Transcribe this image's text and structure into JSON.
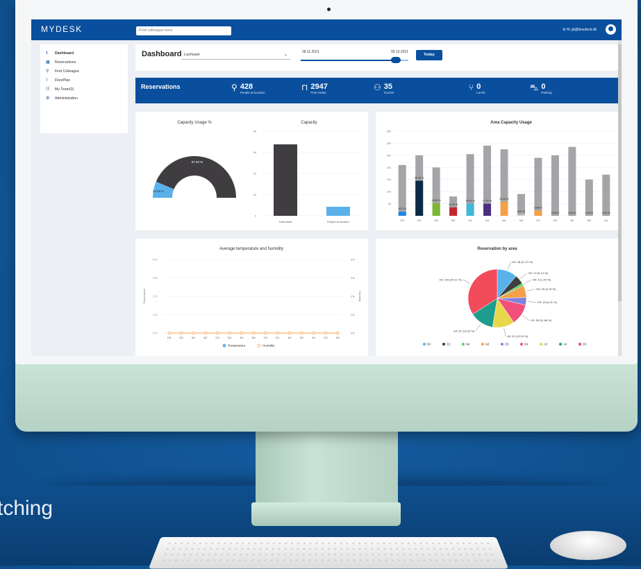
{
  "caption": "tching",
  "app": {
    "logo": "MYDESK",
    "search_placeholder": "Find colleague here",
    "user_greeting": "Hi, jb@bluedock.dk"
  },
  "sidebar": {
    "items": [
      {
        "label": "Dashboard",
        "icon": "chart-line-icon",
        "active": true
      },
      {
        "label": "Reservations",
        "icon": "calendar-icon",
        "active": false
      },
      {
        "label": "Find Colleague",
        "icon": "search-icon",
        "active": false
      },
      {
        "label": "FloorPlan",
        "icon": "chart-line-icon",
        "active": false
      },
      {
        "label": "My Team(3)",
        "icon": "team-icon",
        "active": false
      },
      {
        "label": "Administration",
        "icon": "gear-icon",
        "active": false
      }
    ]
  },
  "filter": {
    "title": "Dashboard",
    "location": "Lavhuset",
    "date_from": "28.11.2021",
    "date_to": "05.12.2021",
    "range_fraction": 0.93,
    "today_label": "Today"
  },
  "reservations": {
    "title": "Reservations",
    "stats": [
      {
        "value": "428",
        "label": "People at location",
        "icon": "map-pin-icon"
      },
      {
        "value": "2947",
        "label": "Free Seats",
        "icon": "seat-icon"
      },
      {
        "value": "35",
        "label": "Guests",
        "icon": "users-icon"
      },
      {
        "value": "0",
        "label": "Lunch",
        "icon": "cutlery-icon"
      },
      {
        "value": "0",
        "label": "Parking",
        "icon": "car-icon"
      }
    ]
  },
  "colors": {
    "primary": "#0a4f9e",
    "dark_bar": "#3f3d40",
    "light_blue": "#5ab1ea",
    "grey_bar": "#a4a5a8",
    "orange_line": "#f4a04a"
  },
  "chart_data": [
    {
      "type": "pie",
      "title": "Capacity Usage %",
      "values": [
        87.32,
        12.68
      ],
      "labels": [
        "87.32 %",
        "12.68 %"
      ],
      "colors": [
        "#3f3d40",
        "#5ab1ea"
      ]
    },
    {
      "type": "bar",
      "title": "Capacity",
      "categories": [
        "Total seats",
        "People at location"
      ],
      "values": [
        3375,
        428
      ],
      "colors": [
        "#3f3d40",
        "#5ab1ea"
      ],
      "ylim": [
        0,
        4000
      ],
      "yticks": [
        "0",
        "1k",
        "2k",
        "3k",
        "4k"
      ]
    },
    {
      "type": "bar",
      "title": "Area Capacity Usage",
      "categories": [
        "D2",
        "D3",
        "A3",
        "N3",
        "O4",
        "D4",
        "A4",
        "N4",
        "O2",
        "D2",
        "A2",
        "N2",
        "A1"
      ],
      "capacity": [
        210,
        250,
        200,
        80,
        255,
        290,
        275,
        90,
        240,
        250,
        285,
        150,
        170
      ],
      "used": [
        17,
        145,
        52,
        35,
        50,
        50,
        58,
        6,
        22,
        0,
        0,
        0,
        0
      ],
      "used_labels": [
        "8.57 %",
        "58.40 %",
        "26.00 %",
        "44.25 %",
        "19.61 %",
        "17.25 %",
        "21.09 %",
        "6.67 %",
        "9.48 %",
        "0.00 %",
        "0.00 %",
        "0.00 %",
        "0.00 %"
      ],
      "used_colors": [
        "#1e88e5",
        "#0b2a45",
        "#7cb82f",
        "#c1272d",
        "#3fb7d9",
        "#4a2f7e",
        "#f4a04a",
        "#c9c9c9",
        "#f4a04a",
        "#c9c9c9",
        "#c9c9c9",
        "#c9c9c9",
        "#c9c9c9"
      ],
      "ylim": [
        0,
        350
      ],
      "yticks": [
        "0",
        "50",
        "100",
        "150",
        "200",
        "250",
        "300",
        "350"
      ]
    },
    {
      "type": "line",
      "title": "Average temperature and humidity",
      "categories": [
        "D3",
        "D3",
        "A3",
        "N3",
        "O3",
        "D4",
        "A4",
        "N4",
        "O2",
        "D2",
        "A2",
        "N2",
        "A1",
        "O2",
        "D2"
      ],
      "series": [
        {
          "name": "Temperature",
          "values": [
            0,
            0,
            0,
            0,
            0,
            0,
            0,
            0,
            0,
            0,
            0,
            0,
            0,
            0,
            0
          ],
          "color": "#5ab1ea"
        },
        {
          "name": "Humidity",
          "values": [
            0,
            0,
            0,
            0,
            0,
            0,
            0,
            0,
            0,
            0,
            0,
            0,
            0,
            0,
            0
          ],
          "color": "#f4a04a"
        }
      ],
      "ylabel": "Temperature",
      "y2label": "Humidity",
      "yticks": [
        "0°C",
        "1°C",
        "2°C",
        "3°C",
        "4°C"
      ],
      "y2ticks": [
        "0%",
        "1%",
        "2%",
        "3%",
        "4%"
      ]
    },
    {
      "type": "pie",
      "title": "Reservation by area",
      "slices": [
        {
          "name": "D4",
          "value": 48,
          "label": "D4: 48 (11.21 %)",
          "color": "#5ab1ea"
        },
        {
          "name": "O2",
          "value": 22,
          "label": "O2: 22 (5.14 %)",
          "color": "#3f3d40"
        },
        {
          "name": "N4",
          "value": 6,
          "label": "N4: 6 (1.40 %)",
          "color": "#5bd25b"
        },
        {
          "name": "N3",
          "value": 29,
          "label": "N3: 29 (6.78 %)",
          "color": "#f4a04a"
        },
        {
          "name": "O3",
          "value": 18,
          "label": "O3: 18 (4.21 %)",
          "color": "#8080e0"
        },
        {
          "name": "O4",
          "value": 50,
          "label": "O4: 50 (11.68 %)",
          "color": "#f0507a"
        },
        {
          "name": "A3",
          "value": 52,
          "label": "A3: 52 (12.15 %)",
          "color": "#e6d84a"
        },
        {
          "name": "A4",
          "value": 57,
          "label": "A4: 57 (13.32 %)",
          "color": "#1d9d8c"
        },
        {
          "name": "D3",
          "value": 146,
          "label": "D3: 146 (34.11 %)",
          "color": "#f24b5a"
        }
      ]
    }
  ]
}
